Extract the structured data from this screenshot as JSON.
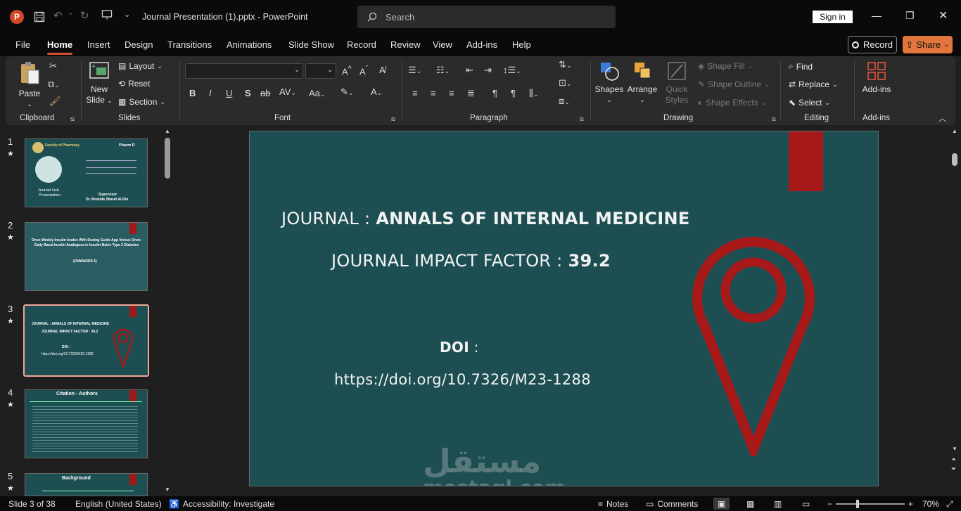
{
  "titlebar": {
    "doc_title": "Journal Presentation (1).pptx  -  PowerPoint",
    "search_placeholder": "Search",
    "sign_in": "Sign in"
  },
  "tabs": [
    "File",
    "Home",
    "Insert",
    "Design",
    "Transitions",
    "Animations",
    "Slide Show",
    "Record",
    "Review",
    "View",
    "Add-ins",
    "Help"
  ],
  "actions": {
    "record": "Record",
    "share": "Share"
  },
  "ribbon": {
    "clipboard": {
      "paste": "Paste",
      "label": "Clipboard"
    },
    "slides": {
      "new_slide_1": "New",
      "new_slide_2": "Slide",
      "layout": "Layout",
      "reset": "Reset",
      "section": "Section",
      "label": "Slides"
    },
    "font": {
      "label": "Font"
    },
    "paragraph": {
      "label": "Paragraph"
    },
    "drawing": {
      "shapes": "Shapes",
      "arrange": "Arrange",
      "quick_styles_1": "Quick",
      "quick_styles_2": "Styles",
      "shape_fill": "Shape Fill",
      "shape_outline": "Shape Outline",
      "shape_effects": "Shape Effects",
      "label": "Drawing"
    },
    "editing": {
      "find": "Find",
      "replace": "Replace",
      "select": "Select",
      "label": "Editing"
    },
    "addins": {
      "addins": "Add-ins",
      "label": "Add-ins"
    }
  },
  "thumbnails": [
    {
      "num": "1",
      "star": "★",
      "title": "Faculty of Pharmacy",
      "tag": "Pharm D",
      "sub1": "Journal club",
      "sub2": "Presentation",
      "sup1": "Supervisor",
      "sup2": "Dr. Mostafa Sharaf-Al-Din"
    },
    {
      "num": "2",
      "star": "★",
      "title": "Once-Weekly Insulin Icodec With Dosing Guide App Versus Once-Daily Basal Insulin Analogues in Insulin-Naive Type 2 Diabetes",
      "sub": "(ONWARDS 5)"
    },
    {
      "num": "3",
      "star": "★",
      "line1": "JOURNAL : ANNALS OF INTERNAL MEDICINE",
      "line2": "JOURNAL IMPACT FACTOR : 39.2",
      "line3": "DOI :",
      "line4": "https://doi.org/10.7326/M23-1288"
    },
    {
      "num": "4",
      "star": "★",
      "title": "Citation - Authors"
    },
    {
      "num": "5",
      "star": "★",
      "title": "Background"
    }
  ],
  "slide": {
    "journal_prefix": "JOURNAL  : ",
    "journal_name": "ANNALS OF INTERNAL MEDICINE",
    "impact_prefix": "JOURNAL IMPACT FACTOR : ",
    "impact_value": "39.2",
    "doi_label": "DOI",
    "doi_colon": " :",
    "doi_url": "https://doi.org/10.7326/M23-1288",
    "watermark_ar": "مستقل",
    "watermark_en": "mostaql.com"
  },
  "statusbar": {
    "slide_pos": "Slide 3 of 38",
    "language": "English (United States)",
    "accessibility": "Accessibility: Investigate",
    "notes": "Notes",
    "comments": "Comments",
    "zoom": "70%"
  },
  "colors": {
    "slide_bg": "#1d4e52",
    "accent_red": "#a8191a",
    "brand_orange": "#e2763c"
  }
}
